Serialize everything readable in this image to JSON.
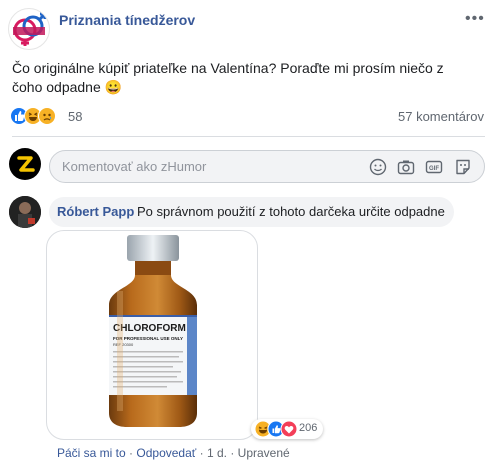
{
  "post": {
    "page_name": "Priznania tínedžerov",
    "more_label": "•••",
    "text": "Čo originálne kúpiť priateľke na Valentína? Poraďte mi prosím niečo z čoho odpadne 😀",
    "reaction_count": "58",
    "comments_count": "57 komentárov",
    "reactions": [
      "like-icon",
      "haha-icon",
      "sad-icon"
    ]
  },
  "composer": {
    "placeholder": "Komentovať ako zHumor",
    "icons": [
      "emoji-icon",
      "camera-icon",
      "gif-icon",
      "sticker-icon"
    ]
  },
  "comment": {
    "author": "Róbert Papp",
    "text": "Po správnom použití z tohoto darčeka určite odpadne",
    "bottle_label": "CHLOROFORM",
    "bottle_sublabel": "FOR PROFESSIONAL USE ONLY",
    "bottle_ref": "REF 20300",
    "reaction_count": "206",
    "actions": {
      "like": "Páči sa mi to",
      "reply": "Odpovedať",
      "time": "1 d.",
      "edited": "Upravené",
      "sep": "·"
    }
  },
  "colors": {
    "link": "#385898",
    "like_blue": "#1877f2",
    "haha_yellow": "#f7b125",
    "love_red": "#f33e58",
    "muted": "#606770"
  }
}
